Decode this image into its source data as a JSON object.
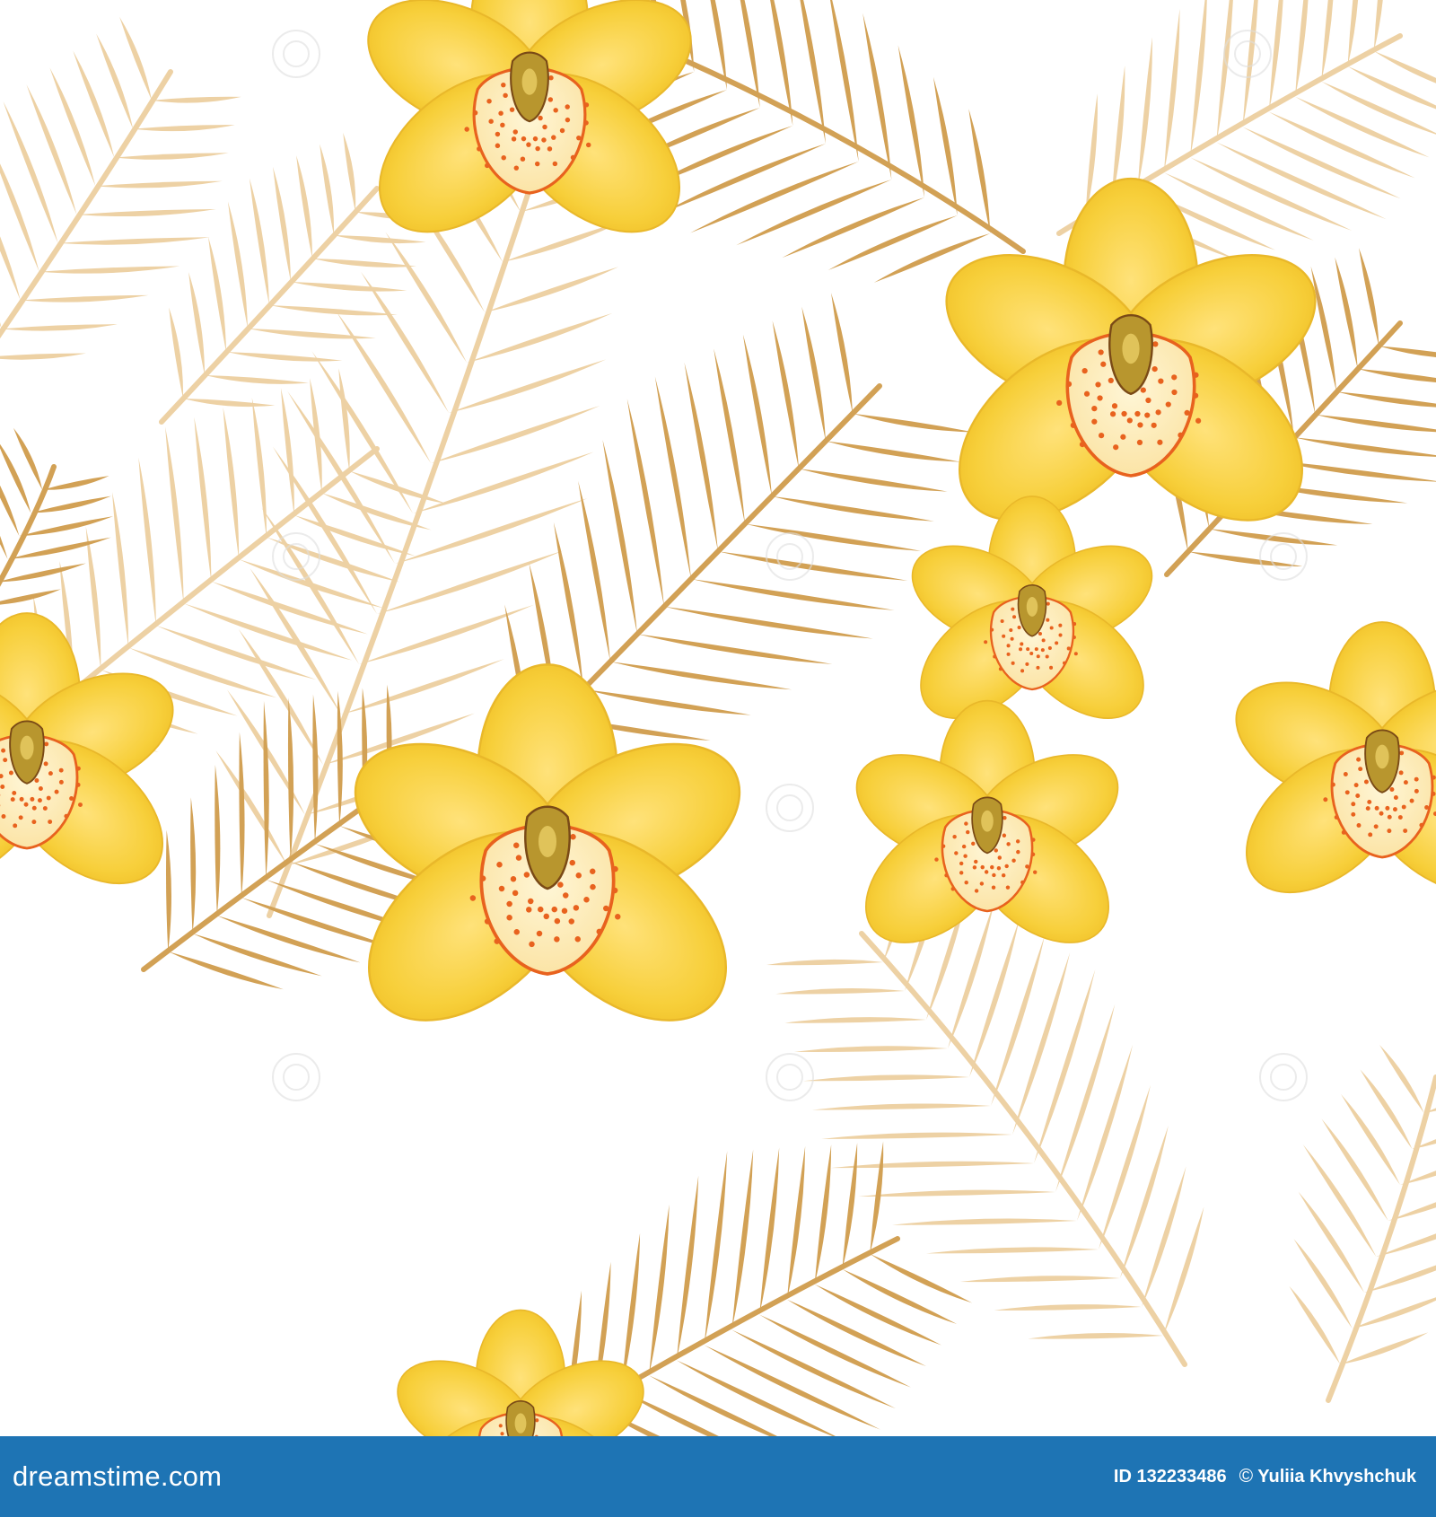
{
  "artwork": {
    "subject": "seamless tropical pattern with yellow orchids and golden palm leaves",
    "background_color": "#ffffff",
    "palette": {
      "petal": "#f7cf3a",
      "petal_light": "#ffe27a",
      "petal_shadow": "#e9b82a",
      "lip": "#fff2c8",
      "lip_spots": "#e8621e",
      "column": "#b8962e",
      "leaf_dark": "#d2a155",
      "leaf_light": "#edd1a4"
    },
    "watermark_text": "dreamstime"
  },
  "footer": {
    "brand": "dreamstime.com",
    "id_label": "ID",
    "id_value": "132233486",
    "copyright_symbol": "©",
    "author": "Yuliia Khvyshchuk",
    "background_color": "#1e74b4"
  }
}
